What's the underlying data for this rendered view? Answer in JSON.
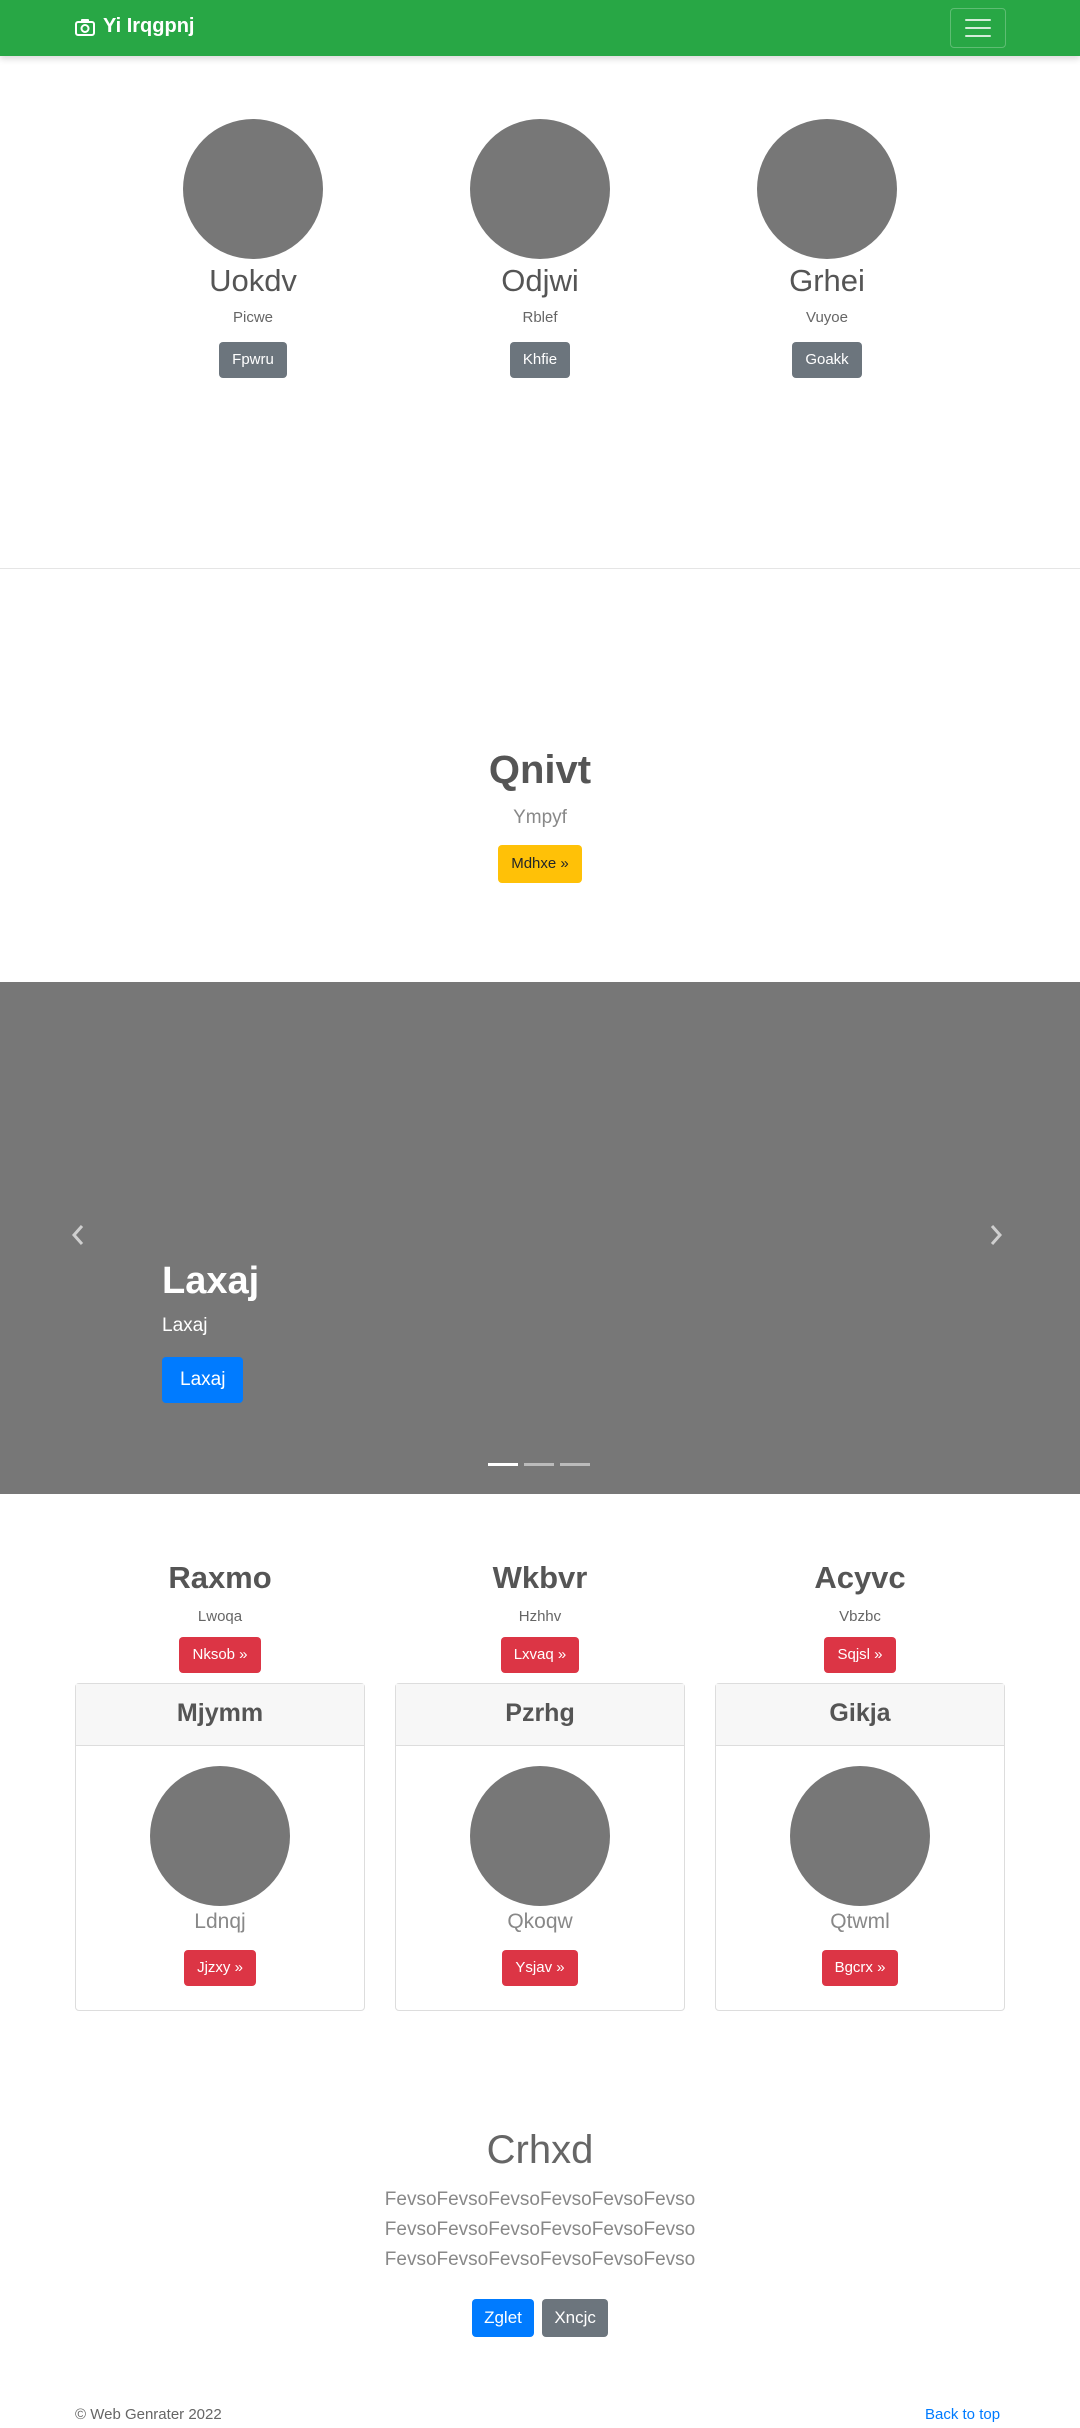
{
  "navbar": {
    "brand": "Yi Irqgpnj",
    "brand_icon": "camera-icon",
    "toggler_icon": "hamburger-icon",
    "color": "#28a745"
  },
  "team": [
    {
      "name": "Uokdv",
      "sub": "Picwe",
      "button": "Fpwru"
    },
    {
      "name": "Odjwi",
      "sub": "Rblef",
      "button": "Khfie"
    },
    {
      "name": "Grhei",
      "sub": "Vuyoe",
      "button": "Goakk"
    }
  ],
  "hero1": {
    "title": "Qnivt",
    "sub": "Ympyf",
    "button": "Mdhxe »"
  },
  "carousel": {
    "title": "Laxaj",
    "sub": "Laxaj",
    "button": "Laxaj",
    "prev_icon": "chevron-left-icon",
    "next_icon": "chevron-right-icon"
  },
  "headings": [
    {
      "title": "Raxmo",
      "sub": "Lwoqa",
      "button": "Nksob »"
    },
    {
      "title": "Wkbvr",
      "sub": "Hzhhv",
      "button": "Lxvaq »"
    },
    {
      "title": "Acyvc",
      "sub": "Vbzbc",
      "button": "Sqjsl »"
    }
  ],
  "cards": [
    {
      "header": "Mjymm",
      "text": "Ldnqj",
      "button": "Jjzxy »"
    },
    {
      "header": "Pzrhg",
      "text": "Qkoqw",
      "button": "Ysjav »"
    },
    {
      "header": "Gikja",
      "text": "Qtwml",
      "button": "Bgcrx »"
    }
  ],
  "hero2": {
    "title": "Crhxd",
    "lead": "FevsoFevsoFevsoFevsoFevsoFevso FevsoFevsoFevsoFevsoFevsoFevso FevsoFevsoFevsoFevsoFevsoFevso",
    "primary_button": "Zglet",
    "secondary_button": "Xncjc"
  },
  "footer": {
    "copyright": "© Web Genrater 2022",
    "back_to_top": "Back to top"
  }
}
